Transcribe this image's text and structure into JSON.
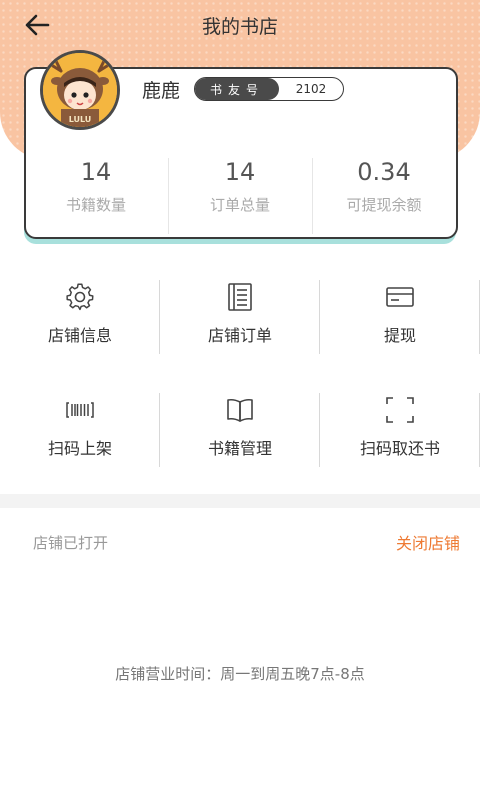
{
  "header": {
    "title": "我的书店",
    "back_icon": "arrow-left-icon",
    "bg_color": "#f9c4a2"
  },
  "profile": {
    "name": "鹿鹿",
    "badge_label": "书友号",
    "badge_value": "2102",
    "avatar_text": "LULU"
  },
  "stats": [
    {
      "value": "14",
      "label": "书籍数量"
    },
    {
      "value": "14",
      "label": "订单总量"
    },
    {
      "value": "0.34",
      "label": "可提现余额"
    }
  ],
  "menu": [
    {
      "label": "店铺信息",
      "icon": "gear-icon"
    },
    {
      "label": "店铺订单",
      "icon": "document-icon"
    },
    {
      "label": "提现",
      "icon": "card-icon"
    },
    {
      "label": "扫码上架",
      "icon": "barcode-icon"
    },
    {
      "label": "书籍管理",
      "icon": "book-icon"
    },
    {
      "label": "扫码取还书",
      "icon": "scan-frame-icon"
    }
  ],
  "shop": {
    "status": "店铺已打开",
    "close_label": "关闭店铺",
    "accent": "#ee7a33",
    "hours": "店铺营业时间：周一到周五晚7点-8点"
  }
}
